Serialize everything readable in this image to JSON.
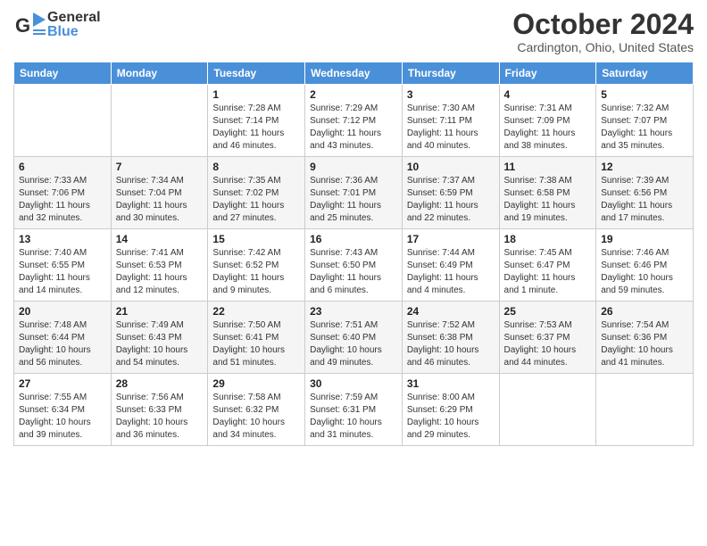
{
  "header": {
    "logo_general": "General",
    "logo_blue": "Blue",
    "month_title": "October 2024",
    "location": "Cardington, Ohio, United States"
  },
  "weekdays": [
    "Sunday",
    "Monday",
    "Tuesday",
    "Wednesday",
    "Thursday",
    "Friday",
    "Saturday"
  ],
  "weeks": [
    [
      {
        "day": "",
        "info": ""
      },
      {
        "day": "",
        "info": ""
      },
      {
        "day": "1",
        "info": "Sunrise: 7:28 AM\nSunset: 7:14 PM\nDaylight: 11 hours and 46 minutes."
      },
      {
        "day": "2",
        "info": "Sunrise: 7:29 AM\nSunset: 7:12 PM\nDaylight: 11 hours and 43 minutes."
      },
      {
        "day": "3",
        "info": "Sunrise: 7:30 AM\nSunset: 7:11 PM\nDaylight: 11 hours and 40 minutes."
      },
      {
        "day": "4",
        "info": "Sunrise: 7:31 AM\nSunset: 7:09 PM\nDaylight: 11 hours and 38 minutes."
      },
      {
        "day": "5",
        "info": "Sunrise: 7:32 AM\nSunset: 7:07 PM\nDaylight: 11 hours and 35 minutes."
      }
    ],
    [
      {
        "day": "6",
        "info": "Sunrise: 7:33 AM\nSunset: 7:06 PM\nDaylight: 11 hours and 32 minutes."
      },
      {
        "day": "7",
        "info": "Sunrise: 7:34 AM\nSunset: 7:04 PM\nDaylight: 11 hours and 30 minutes."
      },
      {
        "day": "8",
        "info": "Sunrise: 7:35 AM\nSunset: 7:02 PM\nDaylight: 11 hours and 27 minutes."
      },
      {
        "day": "9",
        "info": "Sunrise: 7:36 AM\nSunset: 7:01 PM\nDaylight: 11 hours and 25 minutes."
      },
      {
        "day": "10",
        "info": "Sunrise: 7:37 AM\nSunset: 6:59 PM\nDaylight: 11 hours and 22 minutes."
      },
      {
        "day": "11",
        "info": "Sunrise: 7:38 AM\nSunset: 6:58 PM\nDaylight: 11 hours and 19 minutes."
      },
      {
        "day": "12",
        "info": "Sunrise: 7:39 AM\nSunset: 6:56 PM\nDaylight: 11 hours and 17 minutes."
      }
    ],
    [
      {
        "day": "13",
        "info": "Sunrise: 7:40 AM\nSunset: 6:55 PM\nDaylight: 11 hours and 14 minutes."
      },
      {
        "day": "14",
        "info": "Sunrise: 7:41 AM\nSunset: 6:53 PM\nDaylight: 11 hours and 12 minutes."
      },
      {
        "day": "15",
        "info": "Sunrise: 7:42 AM\nSunset: 6:52 PM\nDaylight: 11 hours and 9 minutes."
      },
      {
        "day": "16",
        "info": "Sunrise: 7:43 AM\nSunset: 6:50 PM\nDaylight: 11 hours and 6 minutes."
      },
      {
        "day": "17",
        "info": "Sunrise: 7:44 AM\nSunset: 6:49 PM\nDaylight: 11 hours and 4 minutes."
      },
      {
        "day": "18",
        "info": "Sunrise: 7:45 AM\nSunset: 6:47 PM\nDaylight: 11 hours and 1 minute."
      },
      {
        "day": "19",
        "info": "Sunrise: 7:46 AM\nSunset: 6:46 PM\nDaylight: 10 hours and 59 minutes."
      }
    ],
    [
      {
        "day": "20",
        "info": "Sunrise: 7:48 AM\nSunset: 6:44 PM\nDaylight: 10 hours and 56 minutes."
      },
      {
        "day": "21",
        "info": "Sunrise: 7:49 AM\nSunset: 6:43 PM\nDaylight: 10 hours and 54 minutes."
      },
      {
        "day": "22",
        "info": "Sunrise: 7:50 AM\nSunset: 6:41 PM\nDaylight: 10 hours and 51 minutes."
      },
      {
        "day": "23",
        "info": "Sunrise: 7:51 AM\nSunset: 6:40 PM\nDaylight: 10 hours and 49 minutes."
      },
      {
        "day": "24",
        "info": "Sunrise: 7:52 AM\nSunset: 6:38 PM\nDaylight: 10 hours and 46 minutes."
      },
      {
        "day": "25",
        "info": "Sunrise: 7:53 AM\nSunset: 6:37 PM\nDaylight: 10 hours and 44 minutes."
      },
      {
        "day": "26",
        "info": "Sunrise: 7:54 AM\nSunset: 6:36 PM\nDaylight: 10 hours and 41 minutes."
      }
    ],
    [
      {
        "day": "27",
        "info": "Sunrise: 7:55 AM\nSunset: 6:34 PM\nDaylight: 10 hours and 39 minutes."
      },
      {
        "day": "28",
        "info": "Sunrise: 7:56 AM\nSunset: 6:33 PM\nDaylight: 10 hours and 36 minutes."
      },
      {
        "day": "29",
        "info": "Sunrise: 7:58 AM\nSunset: 6:32 PM\nDaylight: 10 hours and 34 minutes."
      },
      {
        "day": "30",
        "info": "Sunrise: 7:59 AM\nSunset: 6:31 PM\nDaylight: 10 hours and 31 minutes."
      },
      {
        "day": "31",
        "info": "Sunrise: 8:00 AM\nSunset: 6:29 PM\nDaylight: 10 hours and 29 minutes."
      },
      {
        "day": "",
        "info": ""
      },
      {
        "day": "",
        "info": ""
      }
    ]
  ]
}
